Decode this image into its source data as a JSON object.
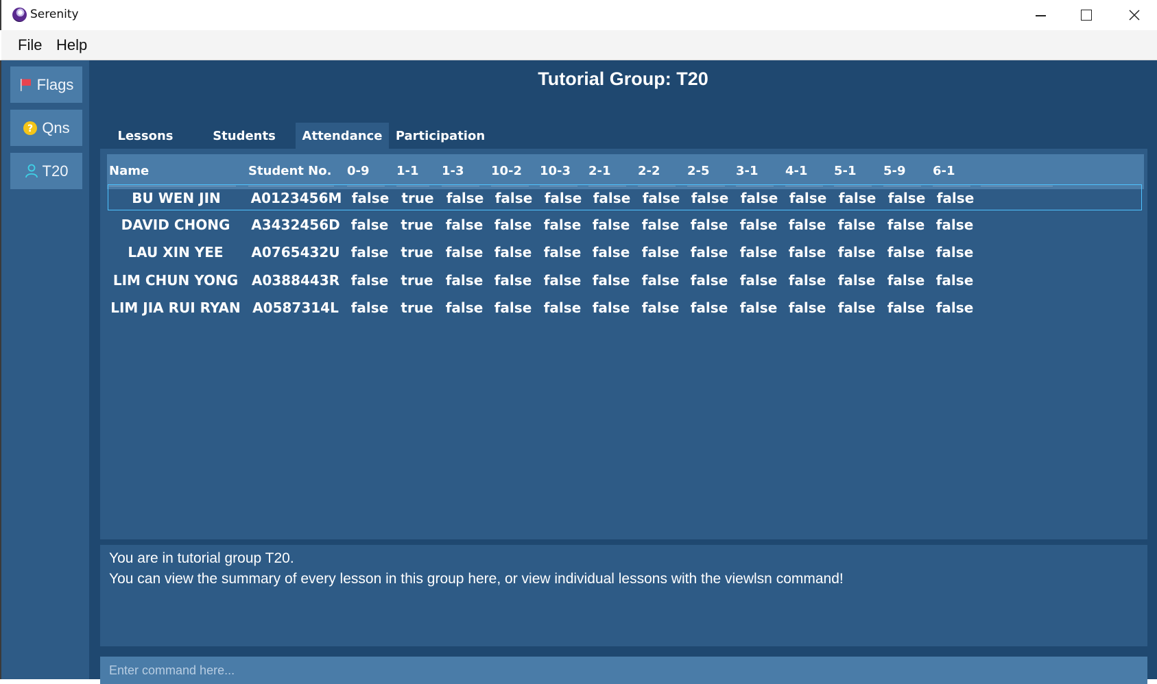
{
  "window": {
    "title": "Serenity",
    "controls": [
      "minimize-icon",
      "maximize-icon",
      "close-icon"
    ]
  },
  "menu": {
    "file": "File",
    "help": "Help"
  },
  "sidebar": {
    "items": [
      {
        "label": "Flags",
        "icon": "flag-icon",
        "icon_color": "#e8434f"
      },
      {
        "label": "Qns",
        "icon": "question-icon",
        "icon_color": "#f5c518"
      },
      {
        "label": "T20",
        "icon": "person-icon",
        "icon_color": "#3fd1e6"
      }
    ]
  },
  "header": {
    "title": "Tutorial Group: T20"
  },
  "tabs": [
    {
      "label": "Lessons",
      "active": false
    },
    {
      "label": "Students",
      "active": false
    },
    {
      "label": "Attendance",
      "active": true
    },
    {
      "label": "Participation",
      "active": false
    }
  ],
  "table": {
    "columns": [
      "Name",
      "Student No.",
      "0-9",
      "1-1",
      "1-3",
      "10-2",
      "10-3",
      "2-1",
      "2-2",
      "2-5",
      "3-1",
      "4-1",
      "5-1",
      "5-9",
      "6-1"
    ],
    "rows": [
      {
        "name": "BU WEN JIN",
        "student_no": "A0123456M",
        "values": [
          "false",
          "true",
          "false",
          "false",
          "false",
          "false",
          "false",
          "false",
          "false",
          "false",
          "false",
          "false",
          "false"
        ],
        "selected": true
      },
      {
        "name": "DAVID CHONG",
        "student_no": "A3432456D",
        "values": [
          "false",
          "true",
          "false",
          "false",
          "false",
          "false",
          "false",
          "false",
          "false",
          "false",
          "false",
          "false",
          "false"
        ],
        "selected": false
      },
      {
        "name": "LAU XIN YEE",
        "student_no": "A0765432U",
        "values": [
          "false",
          "true",
          "false",
          "false",
          "false",
          "false",
          "false",
          "false",
          "false",
          "false",
          "false",
          "false",
          "false"
        ],
        "selected": false
      },
      {
        "name": "LIM CHUN YONG",
        "student_no": "A0388443R",
        "values": [
          "false",
          "true",
          "false",
          "false",
          "false",
          "false",
          "false",
          "false",
          "false",
          "false",
          "false",
          "false",
          "false"
        ],
        "selected": false
      },
      {
        "name": "LIM JIA RUI RYAN",
        "student_no": "A0587314L",
        "values": [
          "false",
          "true",
          "false",
          "false",
          "false",
          "false",
          "false",
          "false",
          "false",
          "false",
          "false",
          "false",
          "false"
        ],
        "selected": false
      }
    ]
  },
  "result": {
    "lines": [
      "You are in tutorial group T20.",
      "You can view the summary of every lesson in this group here, or view individual lessons with the viewlsn command!"
    ]
  },
  "command": {
    "placeholder": "Enter command here...",
    "value": ""
  },
  "colors": {
    "main_bg": "#1f4870",
    "panel_bg": "#2e5b86",
    "header_bg": "#4a7ca8",
    "selection_border": "#4fc3ff"
  }
}
